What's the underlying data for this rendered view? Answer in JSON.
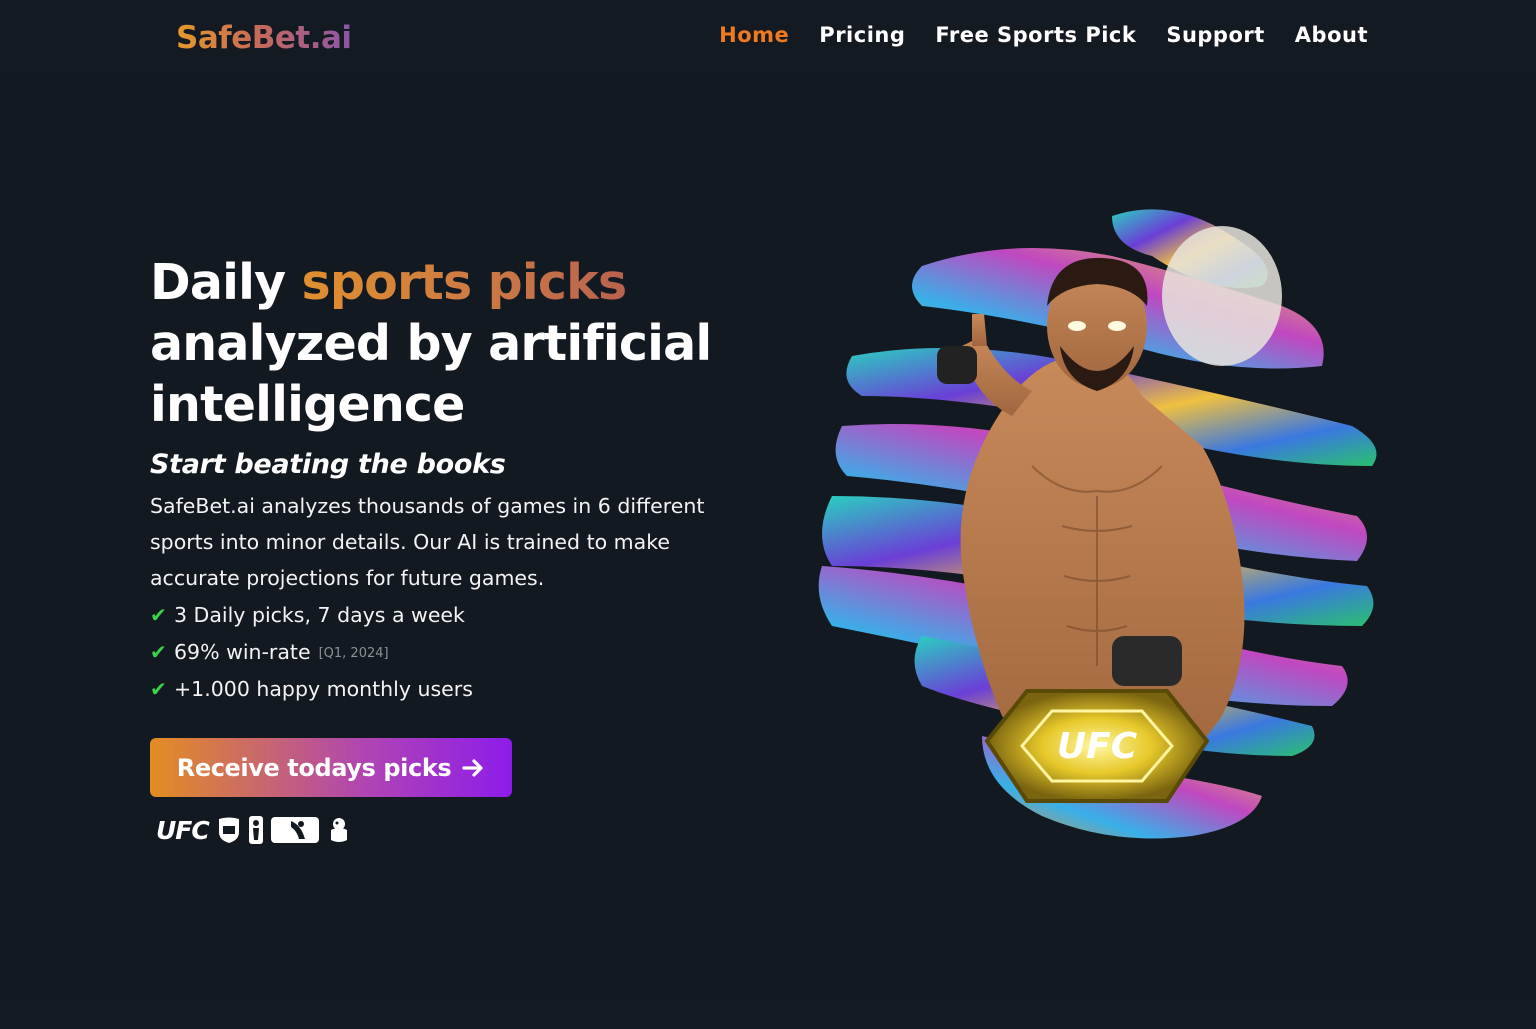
{
  "brand": {
    "name": "SafeBet.ai"
  },
  "nav": {
    "items": [
      {
        "label": "Home",
        "active": true
      },
      {
        "label": "Pricing"
      },
      {
        "label": "Free Sports Pick"
      },
      {
        "label": "Support"
      },
      {
        "label": "About"
      }
    ]
  },
  "hero": {
    "title_part1": "Daily ",
    "title_highlight": "sports picks",
    "title_part2": "analyzed by artificial intelligence",
    "subtitle": "Start beating the books",
    "description": "SafeBet.ai analyzes thousands of games in 6 different sports into minor details. Our AI is trained to make accurate projections for future games.",
    "features": [
      {
        "text": "3 Daily picks, 7 days a week"
      },
      {
        "text": "69% win-rate",
        "note": "[Q1, 2024]"
      },
      {
        "text": "+1.000 happy monthly users"
      }
    ],
    "cta_label": "Receive todays picks",
    "cta_icon": "arrow-right-icon",
    "leagues": {
      "ufc_label": "UFC",
      "icons": [
        "nfl-icon",
        "nba-icon",
        "mlb-icon",
        "premier-league-icon"
      ]
    },
    "artwork": {
      "belt_label": "UFC"
    }
  },
  "colors": {
    "background": "#131920",
    "nav_active": "#ef7a1f",
    "check": "#3ad34a",
    "cta_start": "#e38d22",
    "cta_end": "#8d1cea"
  }
}
